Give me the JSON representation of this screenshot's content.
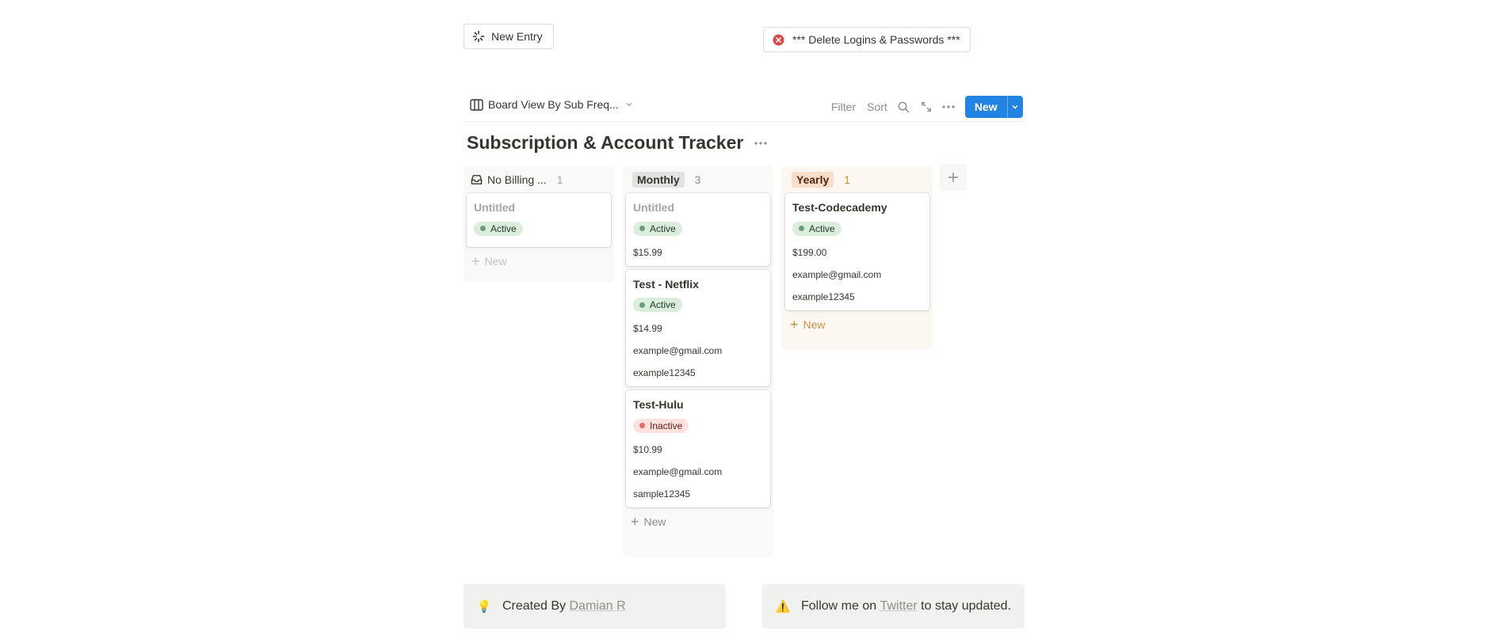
{
  "buttons": {
    "new_entry": "New Entry",
    "delete_logins": "*** Delete Logins & Passwords ***"
  },
  "toolbar": {
    "view_label": "Board View By Sub Freq...",
    "filter": "Filter",
    "sort": "Sort",
    "new": "New"
  },
  "page_title": "Subscription & Account Tracker",
  "colors": {
    "accent": "#2383e2",
    "active_bg": "#dbeddb",
    "active_dot": "#6c9b7d",
    "inactive_bg": "#ffe2dd",
    "inactive_dot": "#e16f64",
    "monthly_pill": "#e3e2e0",
    "yearly_pill": "#fadec9",
    "yearly_bg": "#fcf8f1"
  },
  "board": {
    "columns": [
      {
        "name": "No Billing ...",
        "count": "1",
        "cards": [
          {
            "title": "Untitled",
            "status": "Active"
          }
        ],
        "new_label": "New"
      },
      {
        "name": "Monthly",
        "count": "3",
        "cards": [
          {
            "title": "Untitled",
            "status": "Active",
            "price": "$15.99"
          },
          {
            "title": "Test - Netflix",
            "status": "Active",
            "price": "$14.99",
            "email": "example@gmail.com",
            "password": "example12345"
          },
          {
            "title": "Test-Hulu",
            "status": "Inactive",
            "price": "$10.99",
            "email": "example@gmail.com",
            "password": "sample12345"
          }
        ],
        "new_label": "New"
      },
      {
        "name": "Yearly",
        "count": "1",
        "cards": [
          {
            "title": "Test-Codecademy",
            "status": "Active",
            "price": "$199.00",
            "email": "example@gmail.com",
            "password": "example12345"
          }
        ],
        "new_label": "New"
      }
    ]
  },
  "callouts": {
    "left": {
      "emoji": "💡",
      "prefix": "Created By ",
      "link": "Damian R"
    },
    "right": {
      "emoji": "⚠️",
      "prefix": "Follow me on ",
      "link": "Twitter",
      "suffix": " to stay updated."
    }
  }
}
